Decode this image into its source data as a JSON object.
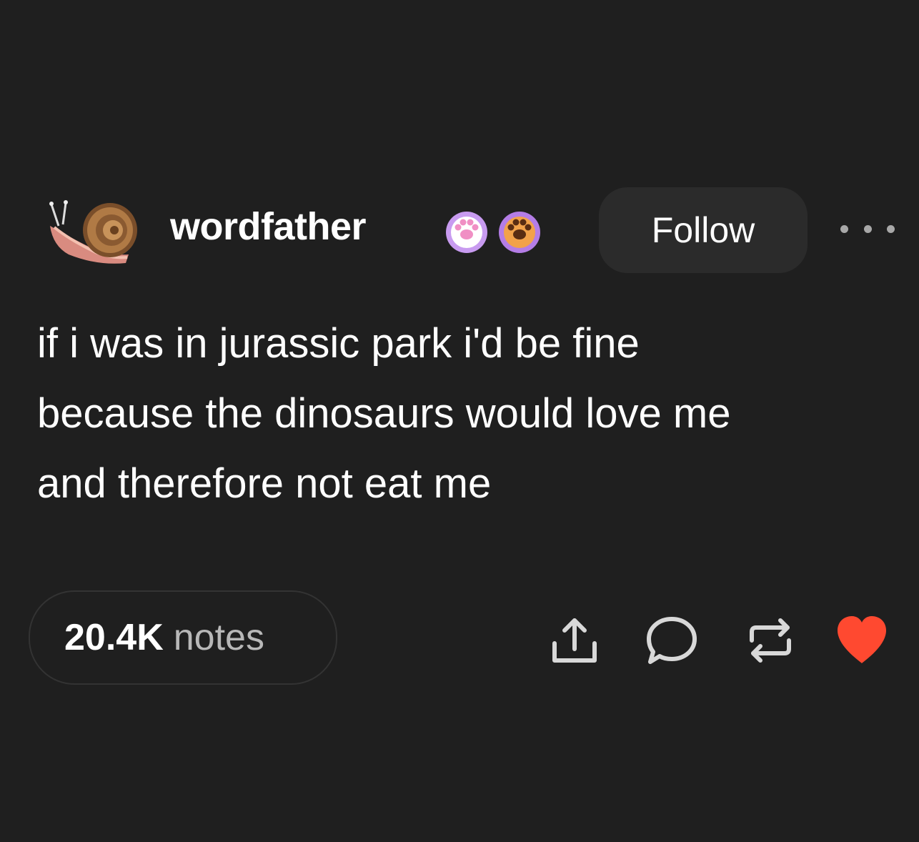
{
  "post": {
    "username": "wordfather",
    "avatar_icon": "snail-avatar-icon",
    "badges": [
      {
        "icon": "paw-badge-icon",
        "color": "#c89bf0"
      },
      {
        "icon": "paw-badge-icon",
        "color": "#b47de6"
      }
    ],
    "follow_label": "Follow",
    "more_icon": "more-dots-icon",
    "body_lines": [
      "if i was in jurassic park i'd be fine",
      "because the dinosaurs would love me",
      "and therefore not eat me"
    ],
    "notes_count": "20.4K",
    "notes_label": "notes",
    "actions": [
      {
        "icon": "share-icon"
      },
      {
        "icon": "reply-icon"
      },
      {
        "icon": "reblog-icon"
      },
      {
        "icon": "heart-icon",
        "color": "#ff4930"
      }
    ]
  }
}
